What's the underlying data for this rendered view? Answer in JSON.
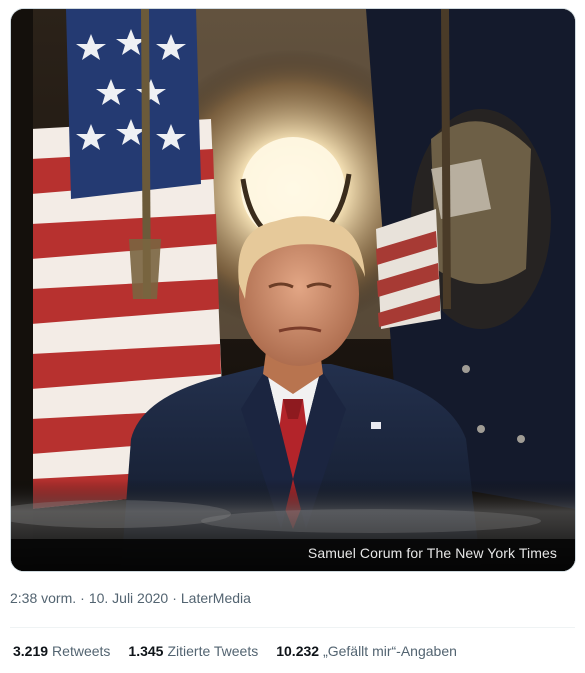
{
  "media": {
    "caption": "Samuel Corum for The New York Times"
  },
  "meta": {
    "time": "2:38 vorm.",
    "separator": "·",
    "date": "10. Juli 2020",
    "source": "LaterMedia"
  },
  "stats": {
    "retweets": {
      "count": "3.219",
      "label": "Retweets"
    },
    "quotes": {
      "count": "1.345",
      "label": "Zitierte Tweets"
    },
    "likes": {
      "count": "10.232",
      "label": "„Gefällt mir“-Angaben"
    }
  },
  "colors": {
    "secondary_text": "#536471",
    "primary_text": "#0f1419",
    "border": "#cfd9de"
  }
}
